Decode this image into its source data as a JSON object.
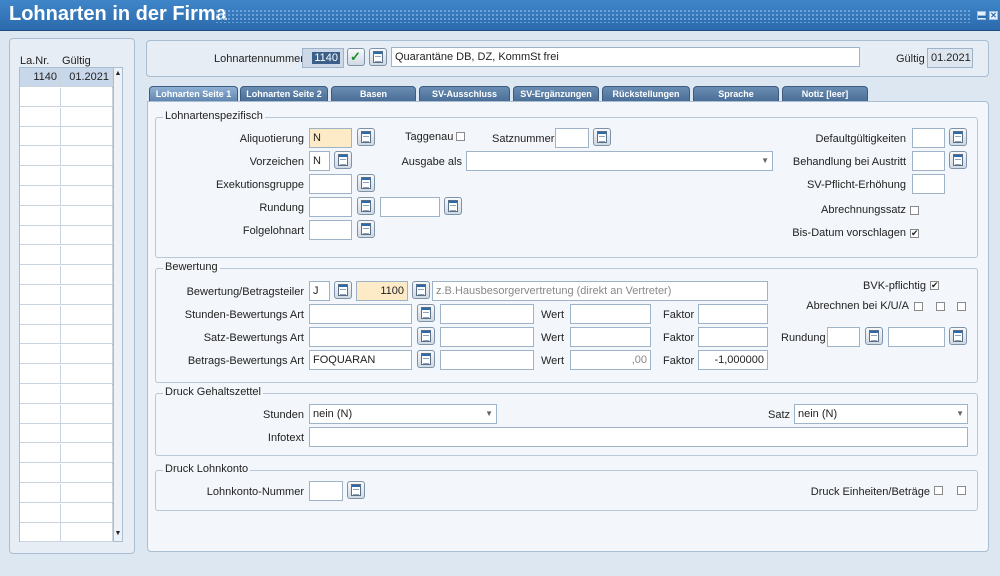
{
  "window": {
    "title": "Lohnarten in der Firma",
    "minimize": "▬",
    "close": "✕"
  },
  "list": {
    "col_nr": "La.Nr.",
    "col_gueltig": "Gültig",
    "rows": [
      {
        "nr": "1140",
        "gueltig": "01.2021"
      }
    ]
  },
  "header": {
    "lohnartennummer_label": "Lohnartennummer",
    "lohnartennummer": "1140",
    "bezeichnung": "Quarantäne DB, DZ, KommSt frei",
    "gueltig_label": "Gültig",
    "gueltig": "01.2021"
  },
  "tabs": [
    "Lohnarten Seite 1",
    "Lohnarten Seite 2",
    "Basen",
    "SV-Ausschluss",
    "SV-Ergänzungen",
    "Rückstellungen",
    "Sprache",
    "Notiz [leer]"
  ],
  "lohnartenspezifisch": {
    "title": "Lohnartenspezifisch",
    "aliquotierung_label": "Aliquotierung",
    "aliquotierung": "N",
    "vorzeichen_label": "Vorzeichen",
    "vorzeichen": "N",
    "exekutionsgruppe_label": "Exekutionsgruppe",
    "rundung_label": "Rundung",
    "folgelohnart_label": "Folgelohnart",
    "taggenau_label": "Taggenau",
    "satznummer_label": "Satznummer",
    "ausgabe_label": "Ausgabe als",
    "defaultgueltigkeiten_label": "Defaultgültigkeiten",
    "behandlung_label": "Behandlung bei Austritt",
    "svpflicht_label": "SV-Pflicht-Erhöhung",
    "abrechnungssatz_label": "Abrechnungssatz",
    "bisdatum_label": "Bis-Datum vorschlagen",
    "bisdatum_checked": "✔"
  },
  "bewertung": {
    "title": "Bewertung",
    "betragsteiler_label": "Bewertung/Betragsteiler",
    "betragsteiler_value": "J",
    "betragsteiler_nr": "1100",
    "betragsteiler_placeholder": "z.B.Hausbesorgervertretung (direkt an Vertreter)",
    "bvk_label": "BVK-pflichtig",
    "bvk_checked": "✔",
    "abrechnen_label": "Abrechnen bei K/U/A",
    "stunden_label": "Stunden-Bewertungs Art",
    "satz_label": "Satz-Bewertungs Art",
    "betrags_label": "Betrags-Bewertungs Art",
    "betrags_value": "FOQUARAN",
    "wert_label": "Wert",
    "faktor_label": "Faktor",
    "betrags_wert": ",00",
    "betrags_faktor": "-1,000000",
    "rundung_label": "Rundung"
  },
  "druck_gehalt": {
    "title": "Druck Gehaltszettel",
    "stunden_label": "Stunden",
    "stunden_value": "nein (N)",
    "satz_label": "Satz",
    "satz_value": "nein (N)",
    "infotext_label": "Infotext"
  },
  "druck_lohnkonto": {
    "title": "Druck Lohnkonto",
    "nummer_label": "Lohnkonto-Nummer",
    "einheiten_label": "Druck Einheiten/Beträge"
  },
  "colors": {
    "titlebar": "#2b6aad",
    "highlight_field": "#fdebc8"
  }
}
